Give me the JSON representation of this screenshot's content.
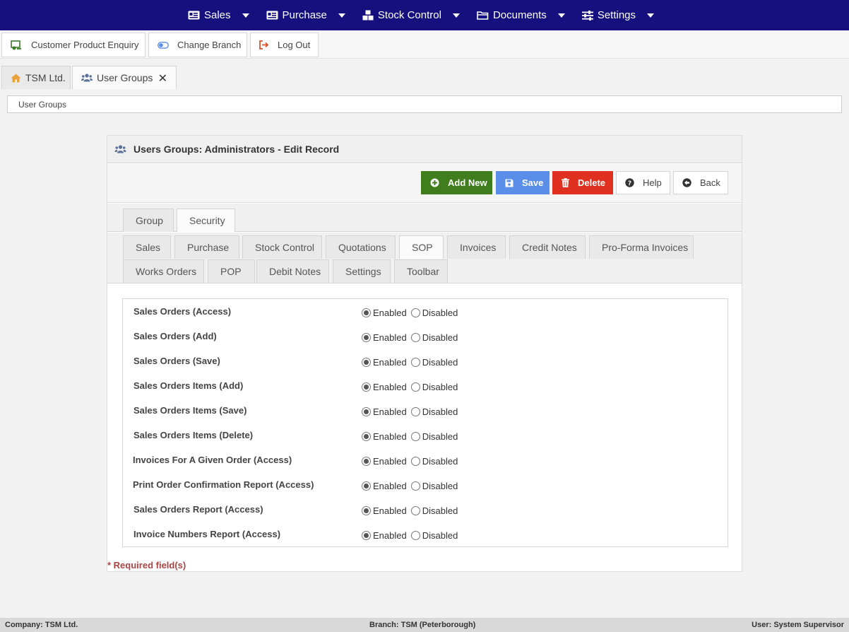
{
  "nav": {
    "items": [
      {
        "label": "Sales",
        "icon": "id-card-icon"
      },
      {
        "label": "Purchase",
        "icon": "id-card-icon"
      },
      {
        "label": "Stock Control",
        "icon": "cubes-icon"
      },
      {
        "label": "Documents",
        "icon": "folder-icon"
      },
      {
        "label": "Settings",
        "icon": "sliders-icon"
      }
    ]
  },
  "toolbar": {
    "enquiry_label": "Customer Product Enquiry",
    "branch_label": "Change Branch",
    "logout_label": "Log Out"
  },
  "page_tabs": [
    {
      "label": "TSM Ltd.",
      "icon": "home-icon"
    },
    {
      "label": "User Groups",
      "icon": "users-icon",
      "close": "✕"
    }
  ],
  "breadcrumb": "User Groups",
  "panel": {
    "title": "Users Groups: Administrators - Edit Record",
    "actions": {
      "add": "Add New",
      "save": "Save",
      "delete": "Delete",
      "help": "Help",
      "back": "Back"
    },
    "main_tabs": [
      "Group",
      "Security"
    ],
    "sub_tabs": [
      "Sales",
      "Purchase",
      "Stock Control",
      "Quotations",
      "SOP",
      "Invoices",
      "Credit Notes",
      "Pro-Forma Invoices",
      "Works Orders",
      "POP",
      "Debit Notes",
      "Settings",
      "Toolbar"
    ],
    "option_enabled": "Enabled",
    "option_disabled": "Disabled",
    "permissions": [
      {
        "label": "Sales Orders (Access)",
        "value": "Enabled"
      },
      {
        "label": "Sales Orders (Add)",
        "value": "Enabled"
      },
      {
        "label": "Sales Orders (Save)",
        "value": "Enabled"
      },
      {
        "label": "Sales Orders Items (Add)",
        "value": "Enabled"
      },
      {
        "label": "Sales Orders Items (Save)",
        "value": "Enabled"
      },
      {
        "label": "Sales Orders Items (Delete)",
        "value": "Enabled"
      },
      {
        "label": "Invoices For A Given Order (Access)",
        "value": "Enabled"
      },
      {
        "label": "Print Order Confirmation Report (Access)",
        "value": "Enabled"
      },
      {
        "label": "Sales Orders Report (Access)",
        "value": "Enabled"
      },
      {
        "label": "Invoice Numbers Report (Access)",
        "value": "Enabled"
      }
    ],
    "required_note": "* Required field(s)"
  },
  "status": {
    "company": "Company: TSM Ltd.",
    "branch": "Branch: TSM (Peterborough)",
    "user": "User: System Supervisor"
  },
  "colors": {
    "nav_bg": "#16107f",
    "add_btn": "#3f7d1d",
    "save_btn": "#5b8ee8",
    "delete_btn": "#e0301f",
    "required_text": "#a94442"
  }
}
